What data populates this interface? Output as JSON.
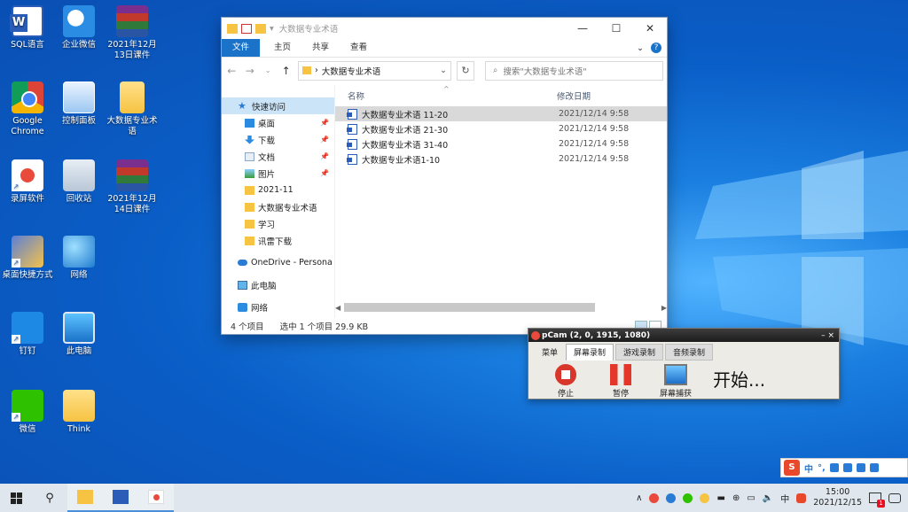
{
  "desktop": {
    "icons": [
      {
        "label": "SQL语言",
        "icon": "word-doc-icon"
      },
      {
        "label": "企业微信",
        "icon": "wechat-work-icon"
      },
      {
        "label": "2021年12月13日课件",
        "icon": "winrar-archive-icon"
      },
      {
        "label": "Google Chrome",
        "icon": "chrome-icon"
      },
      {
        "label": "控制面板",
        "icon": "control-panel-icon"
      },
      {
        "label": "大数据专业术语",
        "icon": "folder-icon"
      },
      {
        "label": "录屏软件",
        "icon": "screen-recorder-icon"
      },
      {
        "label": "回收站",
        "icon": "recycle-bin-icon"
      },
      {
        "label": "2021年12月14日课件",
        "icon": "winrar-archive-icon"
      },
      {
        "label": "桌面快捷方式",
        "icon": "shortcut-icon"
      },
      {
        "label": "网络",
        "icon": "network-globe-icon"
      },
      {
        "label": "钉钉",
        "icon": "dingtalk-icon"
      },
      {
        "label": "此电脑",
        "icon": "this-pc-icon"
      },
      {
        "label": "微信",
        "icon": "wechat-icon"
      },
      {
        "label": "Think",
        "icon": "folder-user-icon"
      }
    ]
  },
  "explorer": {
    "title": "大数据专业术语",
    "ribbon_tabs": [
      "文件",
      "主页",
      "共享",
      "查看"
    ],
    "address": "大数据专业术语",
    "search_placeholder": "搜索\"大数据专业术语\"",
    "nav": {
      "quick_access": "快速访问",
      "pinned": [
        "桌面",
        "下载",
        "文档",
        "图片"
      ],
      "recent": [
        "2021-11",
        "大数据专业术语",
        "学习",
        "讯雷下载"
      ],
      "onedrive": "OneDrive - Persona",
      "this_pc": "此电脑",
      "network": "网络"
    },
    "columns": {
      "name": "名称",
      "modified": "修改日期"
    },
    "files": [
      {
        "name": "大数据专业术语 11-20",
        "modified": "2021/12/14 9:58",
        "selected": true
      },
      {
        "name": "大数据专业术语 21-30",
        "modified": "2021/12/14 9:58",
        "selected": false
      },
      {
        "name": "大数据专业术语 31-40",
        "modified": "2021/12/14 9:58",
        "selected": false
      },
      {
        "name": "大数据专业术语1-10",
        "modified": "2021/12/14 9:58",
        "selected": false
      }
    ],
    "status": {
      "count": "4 个项目",
      "selection": "选中 1 个项目  29.9 KB"
    }
  },
  "recorder": {
    "title": "pCam (2, 0, 1915, 1080)",
    "tabs": [
      "菜单",
      "屏幕录制",
      "游戏录制",
      "音频录制"
    ],
    "buttons": {
      "stop": "停止",
      "pause": "暂停",
      "capture": "屏幕捕获"
    },
    "status_text": "开始..."
  },
  "ime": {
    "mode": "中",
    "punct": "°,"
  },
  "taskbar": {
    "clock_time": "15:00",
    "clock_date": "2021/12/15",
    "tray_lang": "中",
    "notification_count": "1"
  },
  "colors": {
    "accent": "#1a73c9",
    "selection": "#cce4f7",
    "desktop": "#0a5ec7"
  }
}
